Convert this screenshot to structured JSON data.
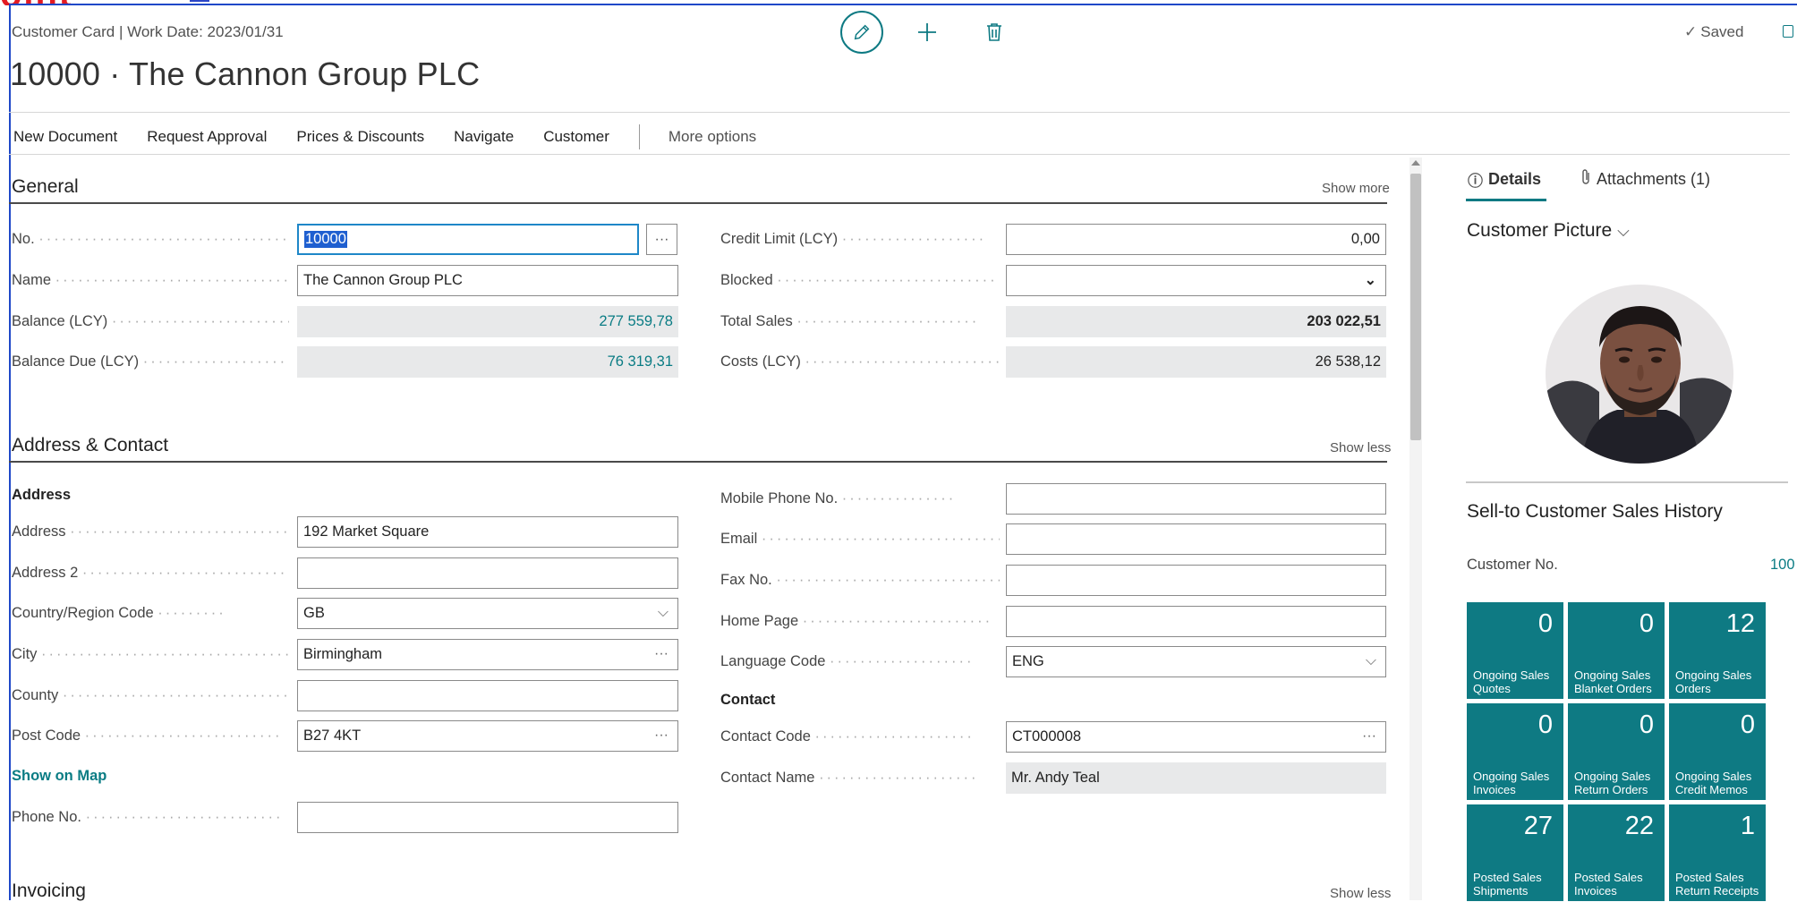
{
  "header": {
    "breadcrumb": "Customer Card | Work Date: 2023/01/31",
    "title": "10000 · The Cannon Group PLC",
    "saved": "Saved"
  },
  "actions": {
    "new_document": "New Document",
    "request_approval": "Request Approval",
    "prices_discounts": "Prices & Discounts",
    "navigate": "Navigate",
    "customer": "Customer",
    "more_options": "More options"
  },
  "general": {
    "title": "General",
    "show": "Show more",
    "no_label": "No.",
    "no_value": "10000",
    "name_label": "Name",
    "name_value": "The Cannon Group PLC",
    "balance_label": "Balance (LCY)",
    "balance_value": "277 559,78",
    "balance_due_label": "Balance Due (LCY)",
    "balance_due_value": "76 319,31",
    "credit_limit_label": "Credit Limit (LCY)",
    "credit_limit_value": "0,00",
    "blocked_label": "Blocked",
    "blocked_value": "",
    "total_sales_label": "Total Sales",
    "total_sales_value": "203 022,51",
    "costs_label": "Costs (LCY)",
    "costs_value": "26 538,12"
  },
  "address": {
    "title": "Address & Contact",
    "show": "Show less",
    "address_group": "Address",
    "address_label": "Address",
    "address_value": "192 Market Square",
    "address2_label": "Address 2",
    "address2_value": "",
    "country_label": "Country/Region Code",
    "country_value": "GB",
    "city_label": "City",
    "city_value": "Birmingham",
    "county_label": "County",
    "county_value": "",
    "post_code_label": "Post Code",
    "post_code_value": "B27 4KT",
    "show_on_map": "Show on Map",
    "phone_label": "Phone No.",
    "phone_value": "",
    "mobile_label": "Mobile Phone No.",
    "mobile_value": "",
    "email_label": "Email",
    "email_value": "",
    "fax_label": "Fax No.",
    "fax_value": "",
    "home_page_label": "Home Page",
    "home_page_value": "",
    "language_label": "Language Code",
    "language_value": "ENG",
    "contact_group": "Contact",
    "contact_code_label": "Contact Code",
    "contact_code_value": "CT000008",
    "contact_name_label": "Contact Name",
    "contact_name_value": "Mr. Andy Teal"
  },
  "invoicing": {
    "title": "Invoicing",
    "show": "Show less"
  },
  "factbox": {
    "tab_details": "Details",
    "tab_attachments": "Attachments (1)",
    "picture_title": "Customer Picture",
    "history_title": "Sell-to Customer Sales History",
    "customer_no_label": "Customer No.",
    "customer_no_value": "100",
    "tiles": [
      {
        "value": "0",
        "label": "Ongoing Sales Quotes"
      },
      {
        "value": "0",
        "label": "Ongoing Sales Blanket Orders"
      },
      {
        "value": "12",
        "label": "Ongoing Sales Orders"
      },
      {
        "value": "0",
        "label": "Ongoing Sales Invoices"
      },
      {
        "value": "0",
        "label": "Ongoing Sales Return Orders"
      },
      {
        "value": "0",
        "label": "Ongoing Sales Credit Memos"
      },
      {
        "value": "27",
        "label": "Posted Sales Shipments"
      },
      {
        "value": "22",
        "label": "Posted Sales Invoices"
      },
      {
        "value": "1",
        "label": "Posted Sales Return Receipts"
      }
    ]
  },
  "colors": {
    "accent": "#0e7a83",
    "frame": "#1f48c8",
    "selection": "#1f5fd0"
  },
  "icons": [
    "edit-icon",
    "plus-icon",
    "delete-icon",
    "check-icon",
    "info-icon",
    "paperclip-icon",
    "chevron-down-icon",
    "ellipsis-icon"
  ]
}
